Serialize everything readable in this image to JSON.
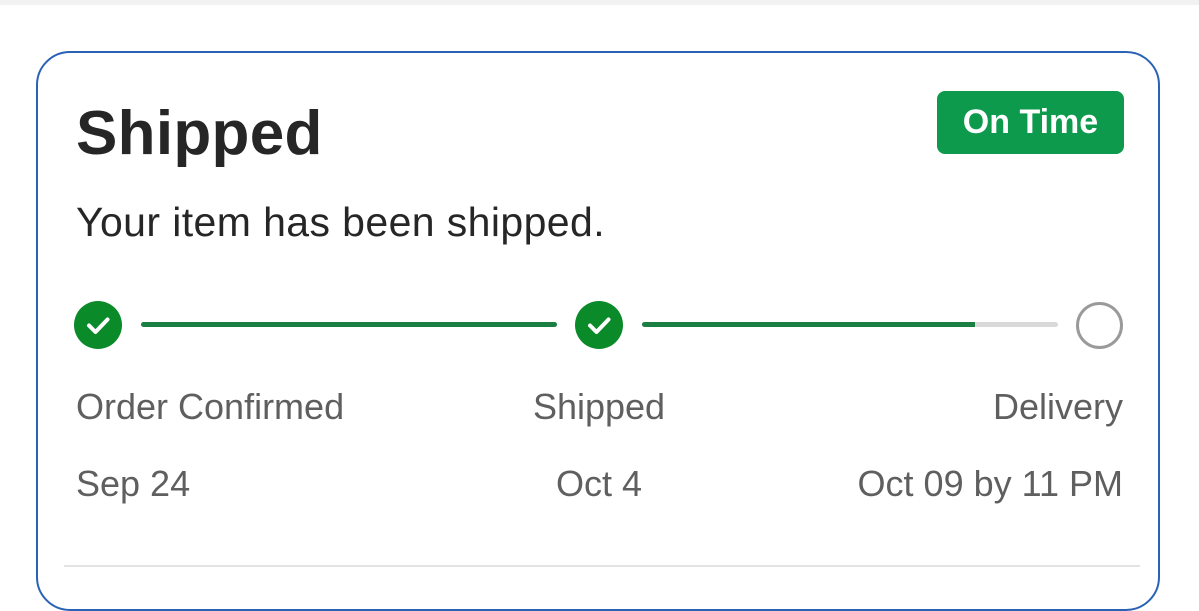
{
  "card": {
    "title": "Shipped",
    "badge": "On Time",
    "subtitle": "Your item has been shipped."
  },
  "progress": {
    "steps": [
      {
        "label": "Order Confirmed",
        "date": "Sep 24",
        "status": "done"
      },
      {
        "label": "Shipped",
        "date": "Oct 4",
        "status": "done"
      },
      {
        "label": "Delivery",
        "date": "Oct 09 by 11 PM",
        "status": "pending"
      }
    ],
    "segment_fill": [
      1.0,
      0.8
    ]
  },
  "colors": {
    "card_border": "#2a62b5",
    "badge_bg": "#0e9a4c",
    "step_done": "#0b8a2a",
    "track_fill": "#1b7f43",
    "track_bg": "#d9d9d9",
    "step_pending_border": "#9a9a9a"
  }
}
